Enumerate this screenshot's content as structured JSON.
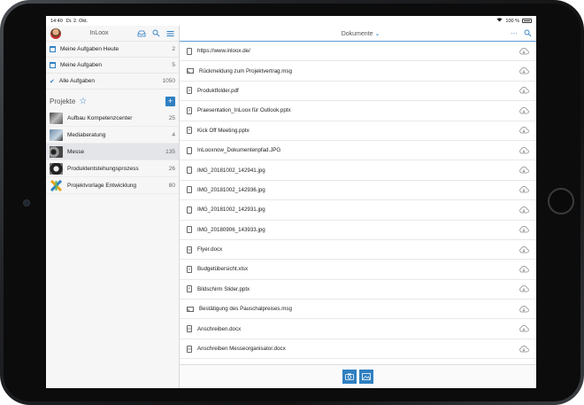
{
  "status": {
    "time": "14:40",
    "date": "Di. 2. Okt.",
    "battery": "100 %"
  },
  "sidebar": {
    "title": "InLoox",
    "tasks": [
      {
        "label": "Meine Aufgaben Heute",
        "count": "2"
      },
      {
        "label": "Meine Aufgaben",
        "count": "5"
      },
      {
        "label": "Alle Aufgaben",
        "count": "1050"
      }
    ],
    "projects_label": "Projekte",
    "add_label": "+",
    "projects": [
      {
        "label": "Aufbau Kompetenzcenter",
        "count": "25"
      },
      {
        "label": "Mediaberatung",
        "count": "4"
      },
      {
        "label": "Messe",
        "count": "135"
      },
      {
        "label": "Produktentstehungsprozess",
        "count": "26"
      },
      {
        "label": "Projektvorlage Entwicklung",
        "count": "80"
      }
    ]
  },
  "main": {
    "title": "Dokumente",
    "files": [
      {
        "label": "https://www.inloox.de/",
        "icon": "doc-icon"
      },
      {
        "label": "Rückmeldung zum Projektvertrag.msg",
        "icon": "mail-icon"
      },
      {
        "label": "Produktfolder.pdf",
        "icon": "pdf-icon"
      },
      {
        "label": "Praesentation_InLoox für Outlook.pptx",
        "icon": "ppt-icon"
      },
      {
        "label": "Kick Off Meeting.pptx",
        "icon": "ppt-icon"
      },
      {
        "label": "InLooxnow_Dokumentenpfad.JPG",
        "icon": "doc-icon"
      },
      {
        "label": "IMG_20181002_142941.jpg",
        "icon": "image-icon"
      },
      {
        "label": "IMG_20181002_142936.jpg",
        "icon": "image-icon"
      },
      {
        "label": "IMG_20181002_142931.jpg",
        "icon": "image-icon"
      },
      {
        "label": "IMG_20180906_143933.jpg",
        "icon": "image-icon"
      },
      {
        "label": "Flyer.docx",
        "icon": "word-icon"
      },
      {
        "label": "Budgetübersicht.xlsx",
        "icon": "excel-icon"
      },
      {
        "label": "Bildschirm Slider.pptx",
        "icon": "ppt-icon"
      },
      {
        "label": "Bestätigung des Pauschalpreises.msg",
        "icon": "mail-icon"
      },
      {
        "label": "Anschreiben.docx",
        "icon": "word-icon"
      },
      {
        "label": "Anschreiben Messeorganisator.docx",
        "icon": "word-icon"
      }
    ]
  },
  "colors": {
    "accent": "#2f7fc1"
  }
}
